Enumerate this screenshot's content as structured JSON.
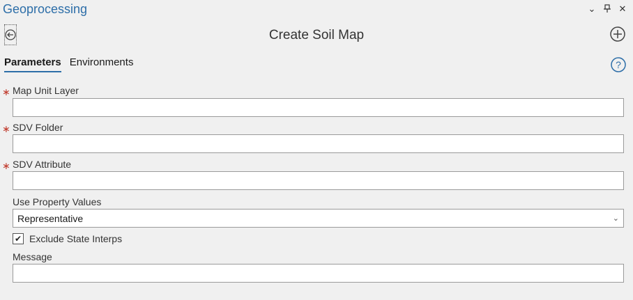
{
  "pane": {
    "title": "Geoprocessing",
    "controls": {
      "options_glyph": "⌄",
      "pin_glyph": "Ⲷ",
      "close_glyph": "✕"
    }
  },
  "tool": {
    "title": "Create Soil Map"
  },
  "tabs": [
    {
      "label": "Parameters",
      "active": true
    },
    {
      "label": "Environments",
      "active": false
    }
  ],
  "fields": {
    "map_unit_layer": {
      "label": "Map Unit Layer",
      "required": true,
      "value": ""
    },
    "sdv_folder": {
      "label": "SDV Folder",
      "required": true,
      "value": ""
    },
    "sdv_attribute": {
      "label": "SDV Attribute",
      "required": true,
      "value": ""
    },
    "use_property_values": {
      "label": "Use Property Values",
      "value": "Representative"
    },
    "exclude_state_interps": {
      "label": "Exclude State Interps",
      "checked": true
    },
    "message": {
      "label": "Message",
      "value": ""
    }
  },
  "glyphs": {
    "required": "∗",
    "check": "✔",
    "dropdown": "⌄"
  },
  "colors": {
    "accent": "#2d6ea8",
    "required": "#c0392b",
    "background": "#f0f0f0"
  }
}
